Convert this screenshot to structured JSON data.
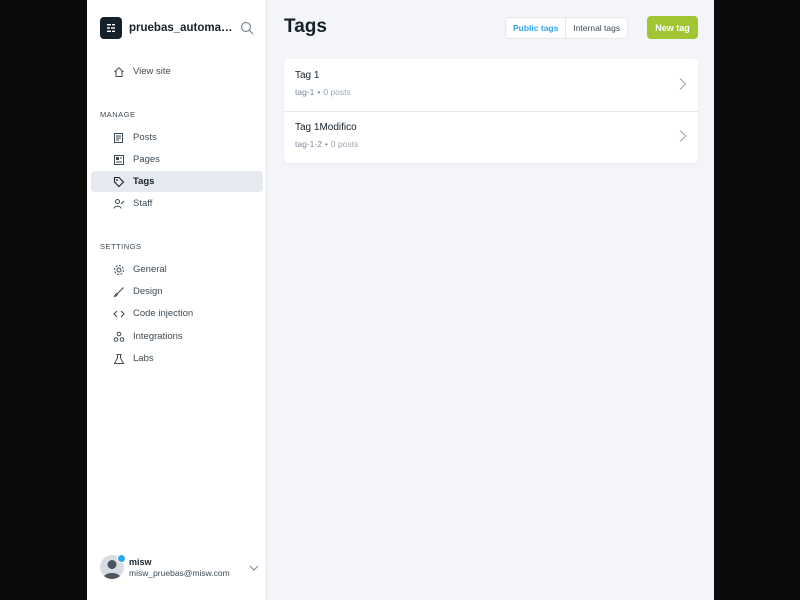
{
  "sidebar": {
    "site_name": "pruebas_automatiz...",
    "view_site": "View site",
    "sections": [
      {
        "title": "MANAGE",
        "items": [
          {
            "label": "Posts",
            "icon": "posts-icon"
          },
          {
            "label": "Pages",
            "icon": "pages-icon"
          },
          {
            "label": "Tags",
            "icon": "tag-icon",
            "active": true
          },
          {
            "label": "Staff",
            "icon": "staff-icon"
          }
        ]
      },
      {
        "title": "SETTINGS",
        "items": [
          {
            "label": "General",
            "icon": "gear-icon"
          },
          {
            "label": "Design",
            "icon": "brush-icon"
          },
          {
            "label": "Code injection",
            "icon": "code-icon"
          },
          {
            "label": "Integrations",
            "icon": "integrations-icon"
          },
          {
            "label": "Labs",
            "icon": "flask-icon"
          }
        ]
      }
    ],
    "user": {
      "name": "misw",
      "email": "misw_pruebas@misw.com"
    }
  },
  "main": {
    "title": "Tags",
    "filters": [
      {
        "label": "Public tags",
        "active": true
      },
      {
        "label": "Internal tags",
        "active": false
      }
    ],
    "new_tag_label": "New tag",
    "tags": [
      {
        "name": "Tag 1",
        "slug": "tag-1",
        "separator": "•",
        "posts": "0 posts"
      },
      {
        "name": "Tag 1Modifico",
        "slug": "tag-1-2",
        "separator": "•",
        "posts": "0 posts"
      }
    ]
  },
  "colors": {
    "accent_green": "#a2c534",
    "accent_blue": "#30a5f1",
    "dark": "#15212a",
    "background": "#f4f5f8"
  }
}
